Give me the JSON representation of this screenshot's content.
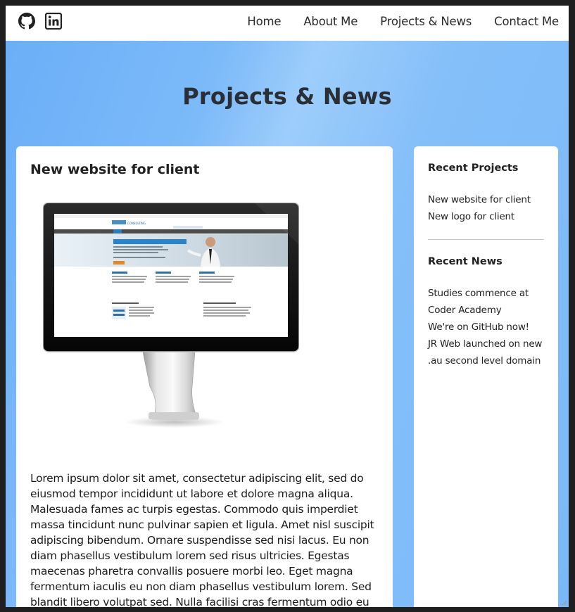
{
  "header": {
    "social": [
      {
        "name": "github-icon"
      },
      {
        "name": "linkedin-icon"
      }
    ],
    "nav": [
      {
        "label": "Home"
      },
      {
        "label": "About Me"
      },
      {
        "label": "Projects & News"
      },
      {
        "label": "Contact Me"
      }
    ]
  },
  "hero": {
    "title": "Projects & News"
  },
  "post": {
    "title": "New website for client",
    "image_icon": "monitor-website-mockup",
    "body": "Lorem ipsum dolor sit amet, consectetur adipiscing elit, sed do eiusmod tempor incididunt ut labore et dolore magna aliqua. Malesuada fames ac turpis egestas. Commodo quis imperdiet massa tincidunt nunc pulvinar sapien et ligula. Amet nisl suscipit adipiscing bibendum. Ornare suspendisse sed nisi lacus. Eu non diam phasellus vestibulum lorem sed risus ultricies. Egestas maecenas pharetra convallis posuere morbi leo. Eget magna fermentum iaculis eu non diam phasellus vestibulum lorem. Sed blandit libero volutpat sed. Nulla facilisi cras fermentum odio eu"
  },
  "sidebar": {
    "recent_projects": {
      "heading": "Recent Projects",
      "items": [
        {
          "label": "New website for client"
        },
        {
          "label": "New logo for client"
        }
      ]
    },
    "recent_news": {
      "heading": "Recent News",
      "items": [
        {
          "label": "Studies commence at Coder Academy"
        },
        {
          "label": "We're on GitHub now!"
        },
        {
          "label": "JR Web launched on new .au second level domain"
        }
      ]
    }
  },
  "colors": {
    "background_gradient": "#7ab9f9",
    "card": "#ffffff",
    "text": "#222222",
    "frame": "#1f1f1f"
  }
}
